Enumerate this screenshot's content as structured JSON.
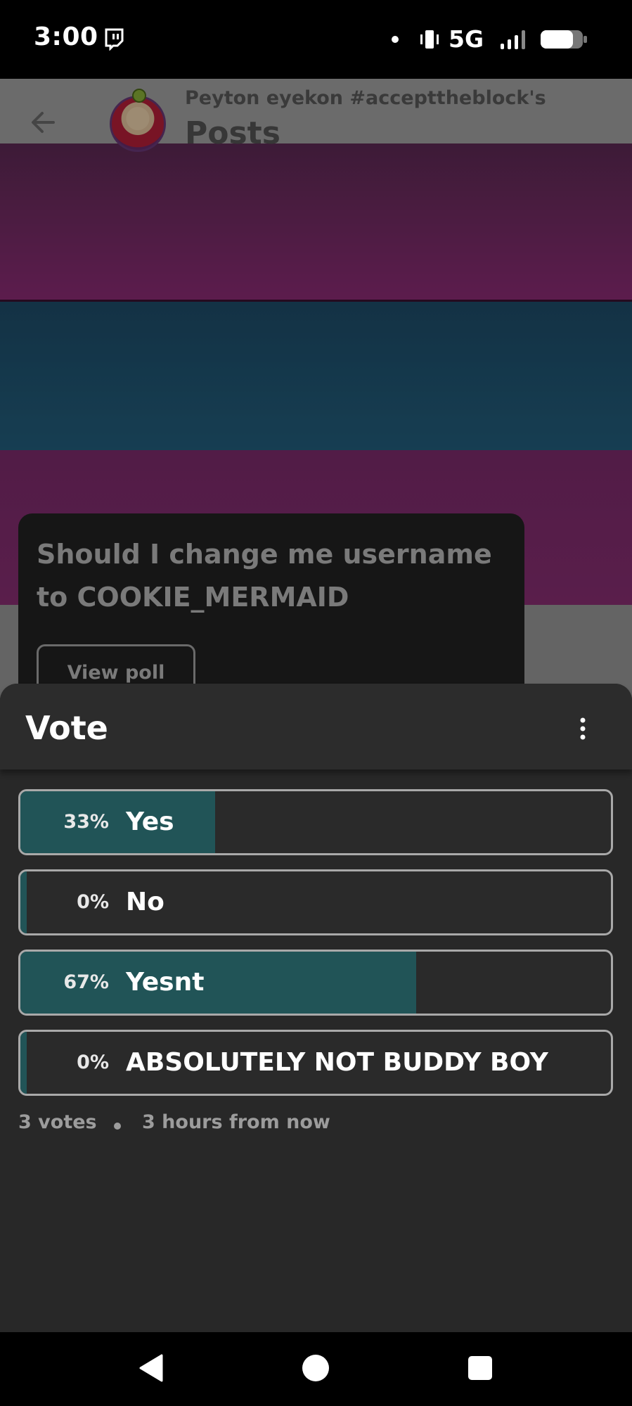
{
  "status_bar": {
    "time": "3:00",
    "network": "5G",
    "icons": [
      "twitch-icon",
      "dot-icon",
      "vibrate-icon",
      "signal-icon",
      "battery-icon"
    ]
  },
  "header": {
    "profile_name": "Peyton eyekon #accepttheblock's",
    "title": "Posts",
    "icons": [
      "back-arrow-icon",
      "avatar"
    ]
  },
  "post": {
    "text": "Should I change me username to COOKIE_MERMAID",
    "view_poll_label": "View poll"
  },
  "sheet": {
    "title": "Vote",
    "menu_icon": "more-vertical-icon",
    "options": [
      {
        "percent": "33%",
        "label": "Yes",
        "fraction": 0.33
      },
      {
        "percent": "0%",
        "label": "No",
        "fraction": 0.0
      },
      {
        "percent": "67%",
        "label": "Yesnt",
        "fraction": 0.67
      },
      {
        "percent": "0%",
        "label": "ABSOLUTELY NOT BUDDY BOY",
        "fraction": 0.0
      }
    ],
    "votes": "3 votes",
    "time_remaining": "3 hours from now"
  },
  "colors": {
    "sheet_bg": "#282828",
    "bar_fill": "#215457",
    "option_border": "#a9a9a9",
    "banner_magenta": "#8e2c77",
    "banner_blue": "#23607f"
  },
  "nav_bar": {
    "icons": [
      "nav-back-icon",
      "nav-home-icon",
      "nav-recents-icon"
    ]
  }
}
